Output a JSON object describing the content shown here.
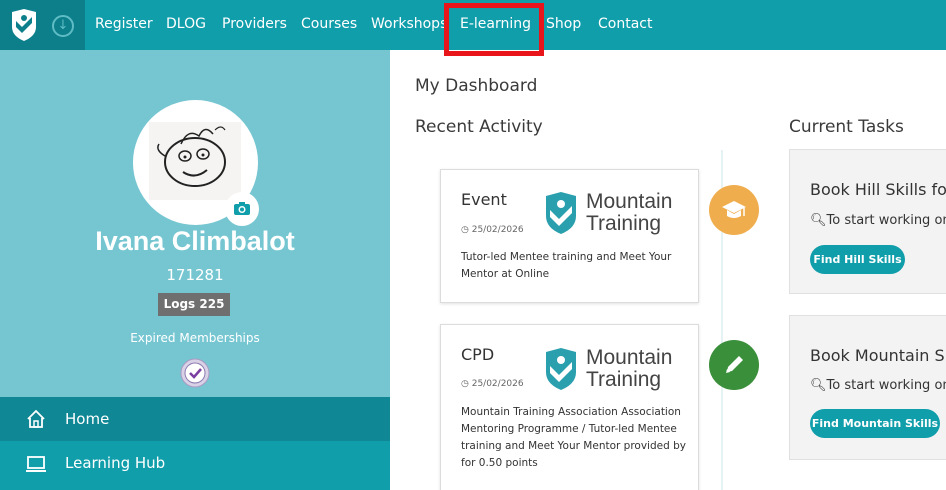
{
  "nav": {
    "items": [
      "Register",
      "DLOG",
      "Providers",
      "Courses",
      "Workshops",
      "E-learning",
      "Shop",
      "Contact"
    ],
    "highlighted": "E-learning"
  },
  "profile": {
    "name": "Ivana Climbalot",
    "id": "171281",
    "logs": "Logs 225",
    "membership_status": "Expired Memberships"
  },
  "sidebar_menu": [
    {
      "label": "Home",
      "icon": "home-icon"
    },
    {
      "label": "Learning Hub",
      "icon": "laptop-icon"
    }
  ],
  "main": {
    "title": "My Dashboard",
    "recent_activity_title": "Recent Activity",
    "current_tasks_title": "Current Tasks"
  },
  "activities": [
    {
      "type": "Event",
      "date": "25/02/2026",
      "description": "Tutor-led Mentee training and Meet Your Mentor at Online",
      "logo_line1": "Mountain",
      "logo_line2": "Training",
      "icon": "graduation-cap-icon",
      "icon_color": "#f0ad4e"
    },
    {
      "type": "CPD",
      "date": "25/02/2026",
      "description": "Mountain Training Association Association Mentoring Programme / Tutor-led Mentee training and Meet Your Mentor provided by for 0.50 points",
      "logo_line1": "Mountain",
      "logo_line2": "Training",
      "icon": "pencil-icon",
      "icon_color": "#3a8f3a"
    }
  ],
  "tasks": [
    {
      "title": "Book Hill Skills for",
      "subtitle": "To start working on",
      "button": "Find Hill Skills"
    },
    {
      "title": "Book Mountain Sk",
      "subtitle": "To start working on",
      "button": "Find Mountain Skills"
    }
  ],
  "colors": {
    "nav_bg": "#119eab",
    "sidebar_bg": "#76c6d2",
    "accent": "#119eab",
    "highlight": "#e8151b"
  }
}
